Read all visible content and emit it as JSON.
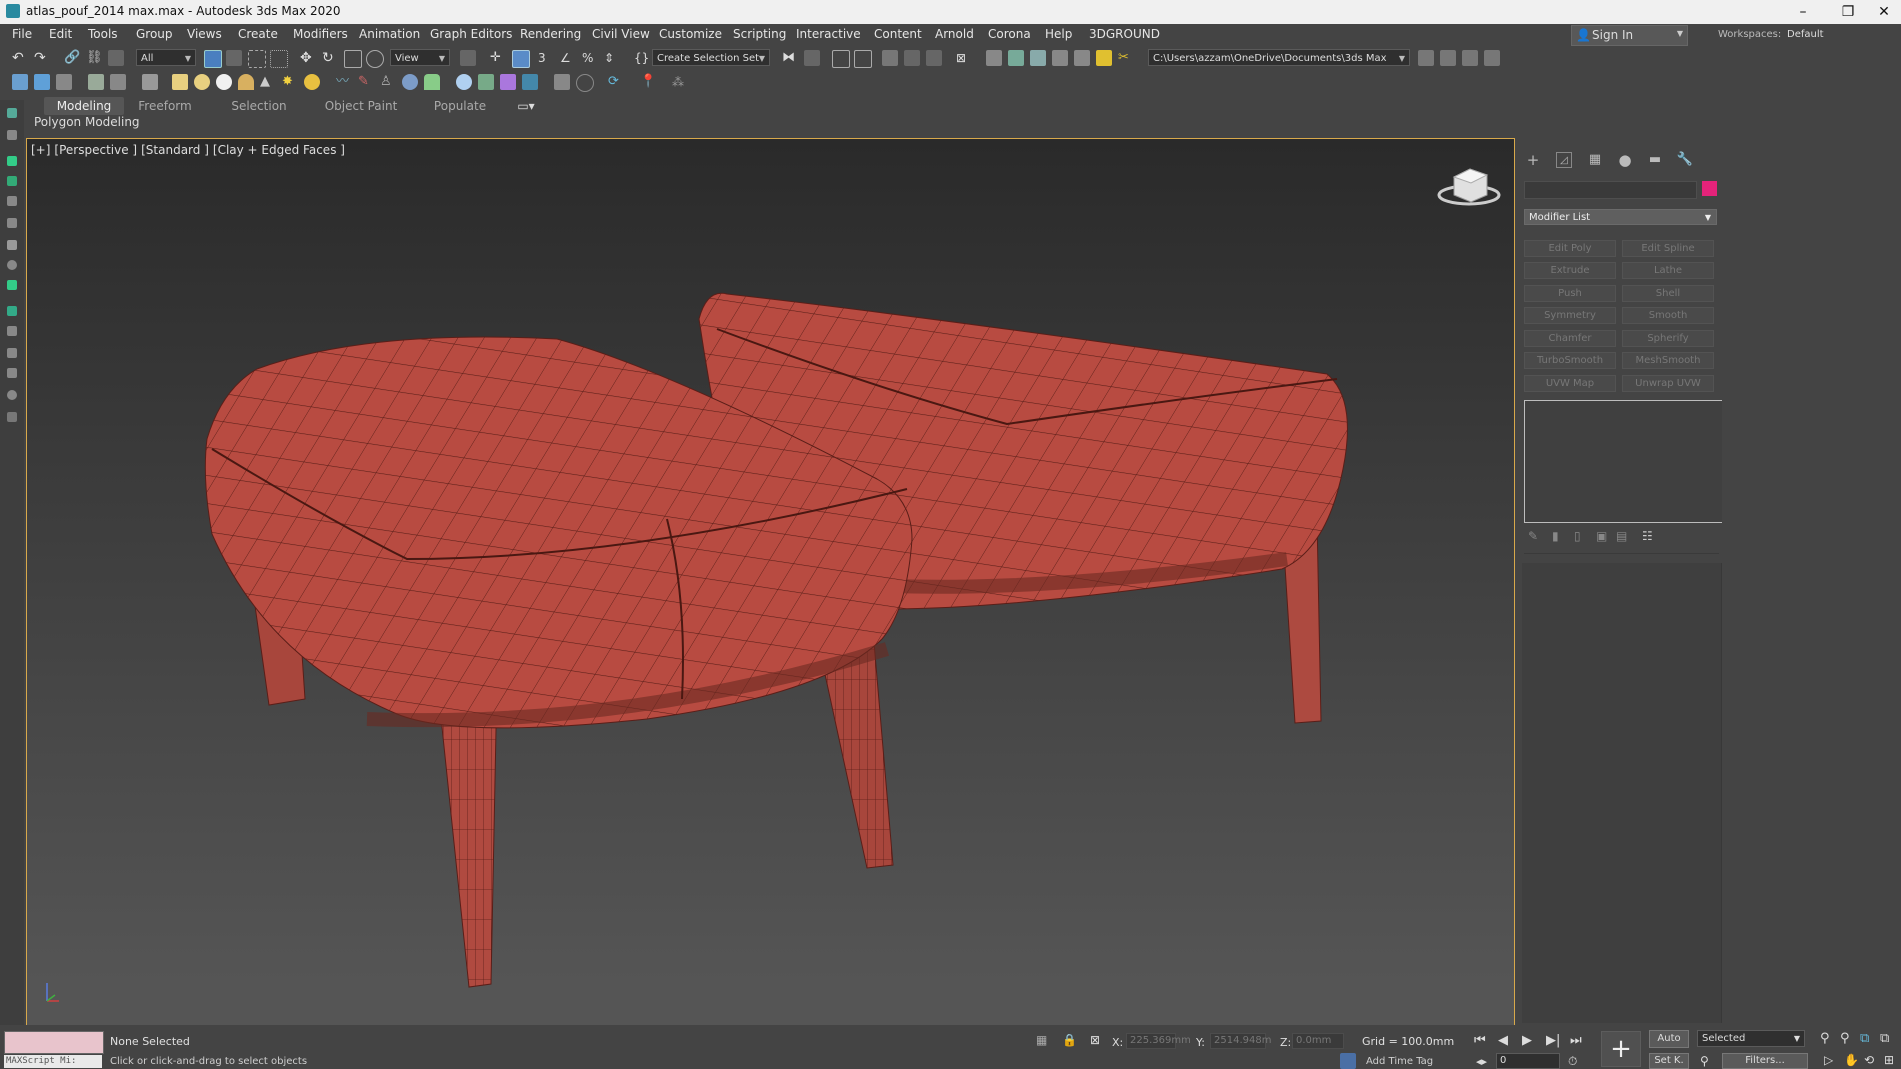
{
  "window": {
    "title": "atlas_pouf_2014 max.max - Autodesk 3ds Max 2020",
    "minimize": "–",
    "restore": "❐",
    "close": "✕"
  },
  "menu": [
    "File",
    "Edit",
    "Tools",
    "Group",
    "Views",
    "Create",
    "Modifiers",
    "Animation",
    "Graph Editors",
    "Rendering",
    "Civil View",
    "Customize",
    "Scripting",
    "Interactive",
    "Content",
    "Arnold",
    "Corona",
    "Help",
    "3DGROUND"
  ],
  "account": {
    "sign_in": "Sign In",
    "workspaces_label": "Workspaces:",
    "workspace": "Default"
  },
  "toolbar": {
    "selection_filter": "All",
    "ref_coord": "View",
    "named_selection": "Create Selection Set",
    "project_path": "C:\\Users\\azzam\\OneDrive\\Documents\\3ds Max 2020"
  },
  "ribbon": {
    "tabs": [
      "Modeling",
      "Freeform",
      "Selection",
      "Object Paint",
      "Populate"
    ],
    "active_tab": "Modeling",
    "panel": "Polygon Modeling"
  },
  "viewport": {
    "labels": [
      "[+]",
      "[Perspective ]",
      "[Standard ]",
      "[Clay + Edged Faces ]"
    ],
    "object_color": "#b84b41"
  },
  "command_panel": {
    "tab_icons": [
      "create-icon",
      "modify-icon",
      "hierarchy-icon",
      "motion-icon",
      "display-icon",
      "utilities-icon"
    ],
    "object_color_swatch": "#e4237a",
    "modifier_list": "Modifier List",
    "modifier_buttons": [
      [
        "Edit Poly",
        "Edit Spline"
      ],
      [
        "Extrude",
        "Lathe"
      ],
      [
        "Push",
        "Shell"
      ],
      [
        "Symmetry",
        "Smooth"
      ],
      [
        "Chamfer",
        "Spherify"
      ],
      [
        "TurboSmooth",
        "MeshSmooth"
      ],
      [
        "UVW Map",
        "Unwrap UVW"
      ]
    ]
  },
  "status": {
    "maxscript": "MAXScript Mi:",
    "selection": "None Selected",
    "prompt": "Click or click-and-drag to select objects",
    "x_label": "X:",
    "x_value": "225.369mm",
    "y_label": "Y:",
    "y_value": "2514.948m",
    "z_label": "Z:",
    "z_value": "0.0mm",
    "grid": "Grid = 100.0mm",
    "add_time_tag": "Add Time Tag",
    "auto_key": "Auto",
    "set_key": "Set K.",
    "key_filter_selected": "Selected",
    "filters": "Filters...",
    "current_frame": "0"
  }
}
